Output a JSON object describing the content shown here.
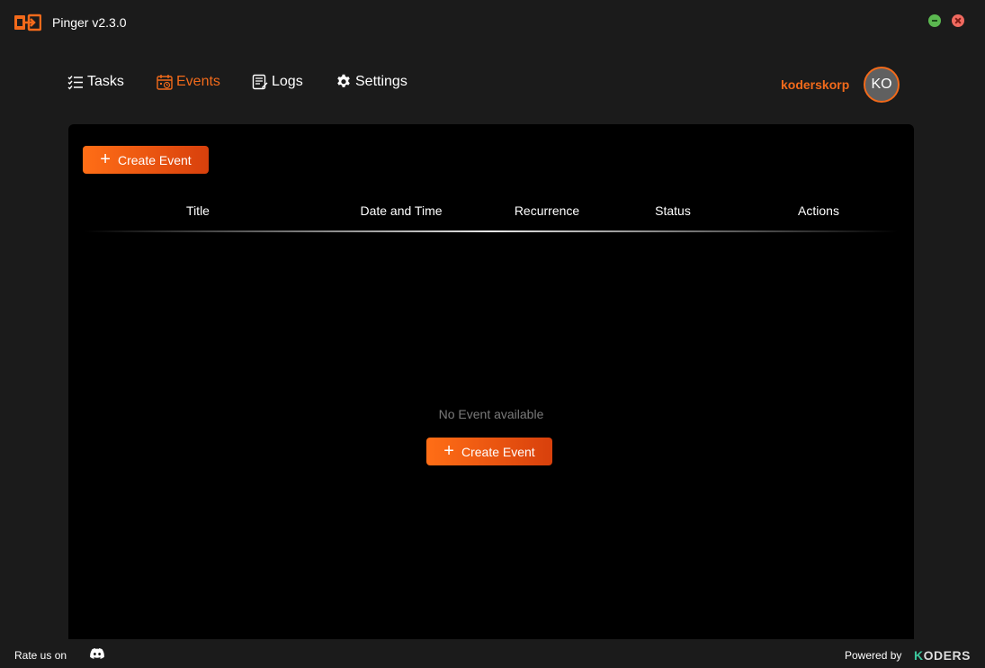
{
  "app": {
    "title": "Pinger v2.3.0",
    "logo_icon": "pinger-logo-icon"
  },
  "window_controls": {
    "minimize_color": "#5bb850",
    "close_color": "#f06a60"
  },
  "nav": {
    "items": [
      {
        "label": "Tasks",
        "icon": "tasks-list-icon",
        "active": false
      },
      {
        "label": "Events",
        "icon": "calendar-clock-icon",
        "active": true
      },
      {
        "label": "Logs",
        "icon": "logs-document-icon",
        "active": false
      },
      {
        "label": "Settings",
        "icon": "gear-icon",
        "active": false
      }
    ]
  },
  "user": {
    "name": "koderskorp",
    "initials": "KO"
  },
  "events": {
    "create_button_label": "Create Event",
    "columns": [
      "Title",
      "Date and Time",
      "Recurrence",
      "Status",
      "Actions"
    ],
    "rows": [],
    "empty_message": "No Event available",
    "empty_create_button_label": "Create Event"
  },
  "footer": {
    "rate_text": "Rate us on",
    "rate_icon": "discord-icon",
    "powered_text": "Powered by",
    "brand_k": "K",
    "brand_rest": "ODERS"
  },
  "colors": {
    "accent": "#f26a1b",
    "background": "#1b1b1b",
    "panel": "#000000"
  }
}
